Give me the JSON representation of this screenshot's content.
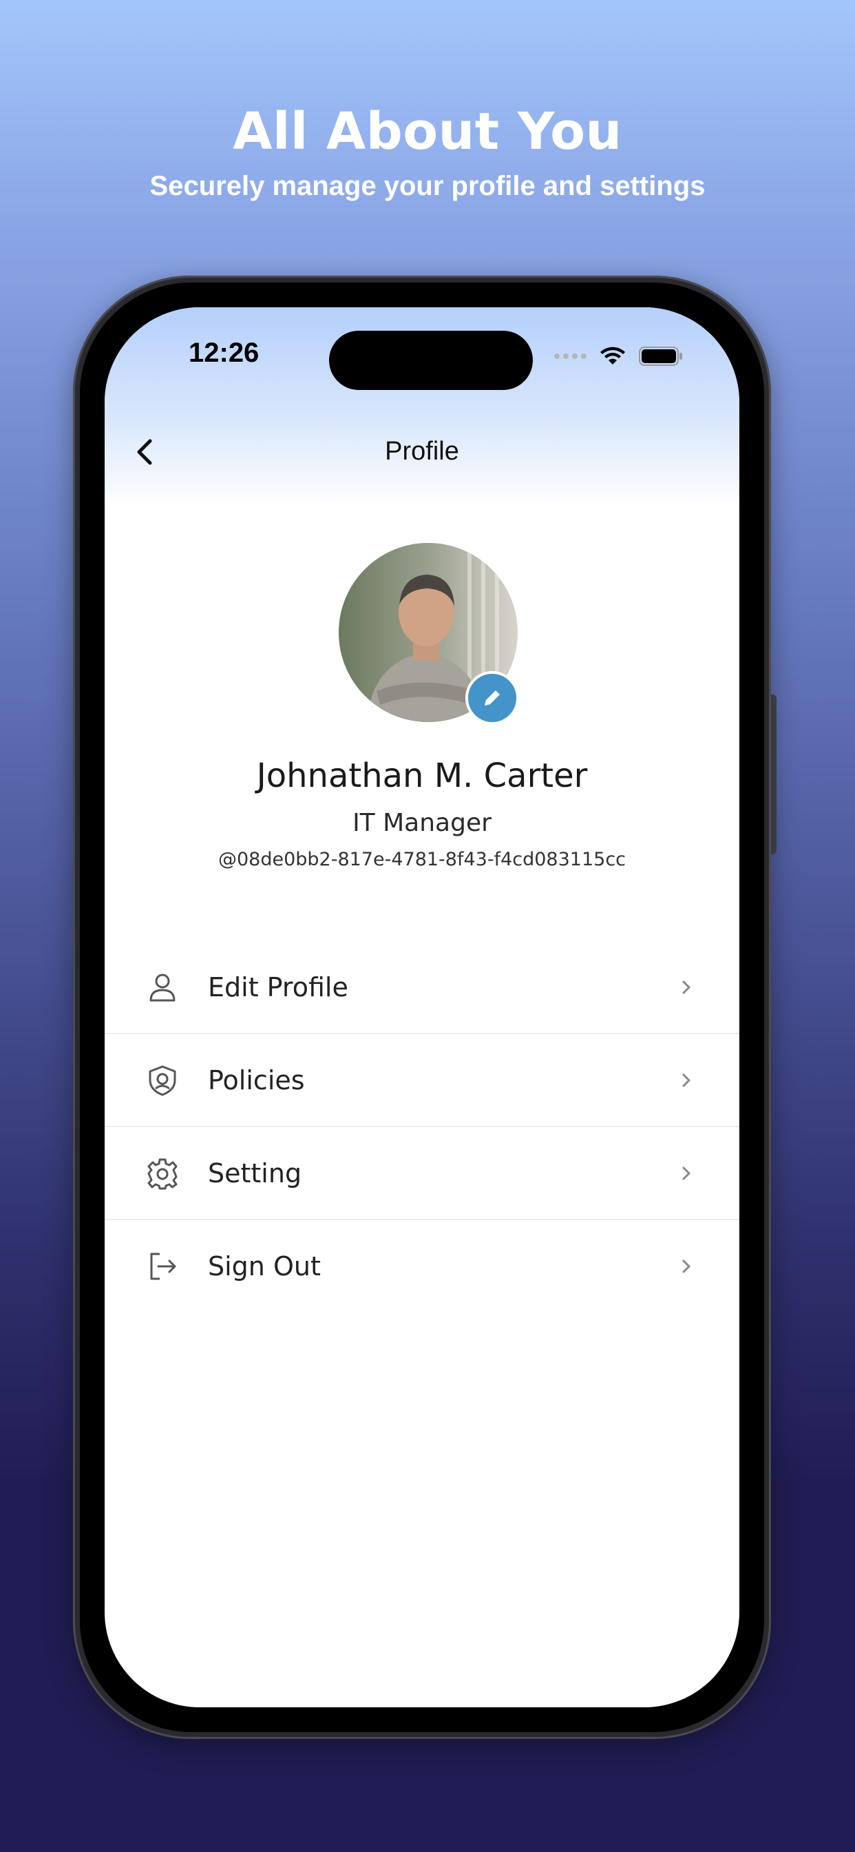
{
  "promo": {
    "title": "All About You",
    "subtitle": "Securely manage your profile and settings"
  },
  "status_bar": {
    "time": "12:26",
    "icons": [
      "signal-icon",
      "wifi-icon",
      "battery-icon"
    ]
  },
  "nav": {
    "title": "Profile",
    "back_icon": "chevron-left-icon"
  },
  "profile": {
    "name": "Johnathan M. Carter",
    "role": "IT Manager",
    "handle": "@08de0bb2-817e-4781-8f43-f4cd083115cc",
    "edit_icon": "pencil-icon"
  },
  "menu": {
    "items": [
      {
        "label": "Edit Profile",
        "icon": "user-icon"
      },
      {
        "label": "Policies",
        "icon": "shield-icon"
      },
      {
        "label": "Setting",
        "icon": "gear-icon"
      },
      {
        "label": "Sign Out",
        "icon": "sign-out-icon"
      }
    ]
  },
  "colors": {
    "accent": "#4493c9",
    "background_top": "#a2c6fb",
    "background_bottom": "#211d54"
  }
}
